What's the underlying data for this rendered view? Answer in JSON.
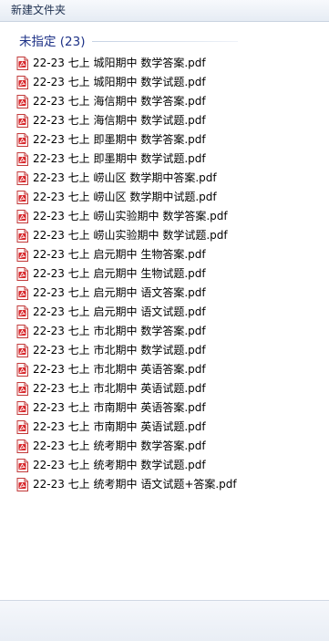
{
  "toolbar": {
    "new_folder_label": "新建文件夹"
  },
  "group": {
    "title": "未指定 (23)"
  },
  "files": [
    "22-23 七上 城阳期中 数学答案.pdf",
    "22-23 七上 城阳期中 数学试题.pdf",
    "22-23 七上 海信期中 数学答案.pdf",
    "22-23 七上 海信期中 数学试题.pdf",
    "22-23 七上 即墨期中 数学答案.pdf",
    "22-23 七上 即墨期中 数学试题.pdf",
    "22-23 七上 崂山区 数学期中答案.pdf",
    "22-23 七上 崂山区 数学期中试题.pdf",
    "22-23 七上 崂山实验期中 数学答案.pdf",
    "22-23 七上 崂山实验期中 数学试题.pdf",
    "22-23 七上 启元期中 生物答案.pdf",
    "22-23 七上 启元期中 生物试题.pdf",
    "22-23 七上 启元期中 语文答案.pdf",
    "22-23 七上 启元期中 语文试题.pdf",
    "22-23 七上 市北期中 数学答案.pdf",
    "22-23 七上 市北期中 数学试题.pdf",
    "22-23 七上 市北期中 英语答案.pdf",
    "22-23 七上 市北期中 英语试题.pdf",
    "22-23 七上 市南期中 英语答案.pdf",
    "22-23 七上 市南期中 英语试题.pdf",
    "22-23 七上 统考期中 数学答案.pdf",
    "22-23 七上 统考期中 数学试题.pdf",
    "22-23 七上 统考期中 语文试题+答案.pdf"
  ],
  "icons": {
    "file": "pdf-file-icon"
  },
  "colors": {
    "group_title": "#1e3287",
    "pdf_icon": "#d8282c"
  }
}
